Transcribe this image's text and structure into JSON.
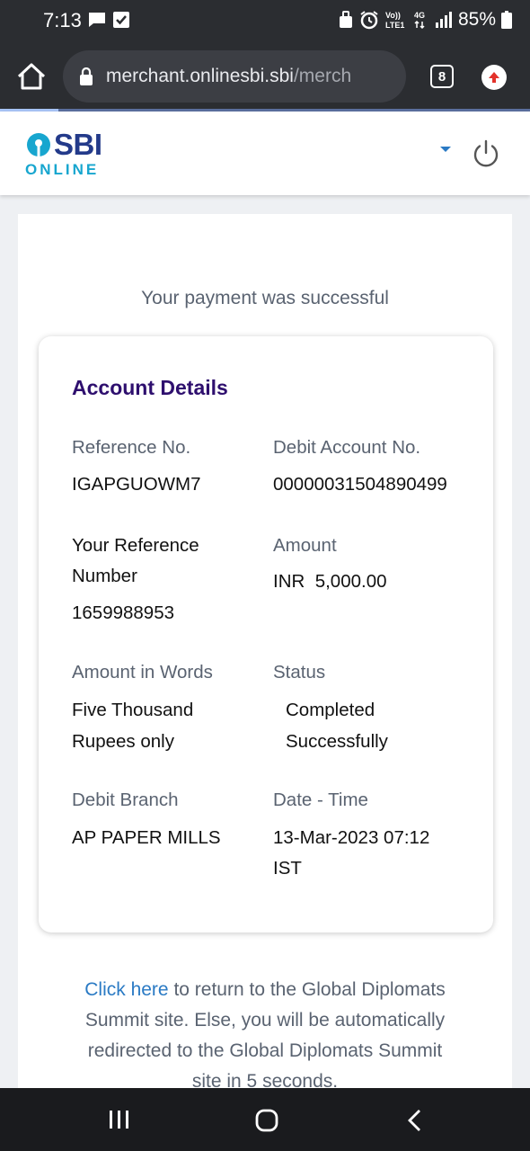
{
  "status_bar": {
    "time": "7:13",
    "battery_pct": "85%",
    "network": "4G",
    "volte": "VoLTE"
  },
  "browser": {
    "url_host": "merchant.onlinesbi.sbi",
    "url_path": "/merch",
    "tab_count": "8",
    "page_load_progress": 0.11
  },
  "header": {
    "logo_sbi": "SBI",
    "logo_online": "ONLINE"
  },
  "page": {
    "success_message": "Your payment was successful",
    "account_details_title": "Account Details",
    "fields": {
      "reference_no_label": "Reference No.",
      "reference_no_value": "IGAPGUOWM7",
      "debit_account_label": "Debit Account No.",
      "debit_account_value": "00000031504890499",
      "your_reference_label_line1": "Your Reference",
      "your_reference_label_line2": "Number",
      "your_reference_value": "1659988953",
      "amount_label": "Amount",
      "amount_value": "INR  5,000.00",
      "amount_words_label": "Amount in Words",
      "amount_words_line1": "Five Thousand",
      "amount_words_line2": "Rupees only",
      "status_label": "Status",
      "status_line1": "Completed",
      "status_line2": "Successfully",
      "debit_branch_label": "Debit Branch",
      "debit_branch_value": "AP PAPER MILLS",
      "datetime_label": "Date - Time",
      "datetime_line1": "13-Mar-2023 07:12",
      "datetime_line2": "IST"
    },
    "redirect": {
      "link_text": "Click here",
      "text_line1": " to return to the Global Diplomats",
      "text_line2": "Summit site. Else, you will be automatically",
      "text_line3": "redirected to the Global Diplomats Summit",
      "text_line4": "site in 5 seconds."
    }
  },
  "colors": {
    "title_purple": "#2e0f6e",
    "link_blue": "#2a7ac4",
    "sbi_blue": "#233a8a",
    "online_cyan": "#17a6cf"
  },
  "icons": [
    "chat-icon",
    "check-box-icon",
    "alarm-icon",
    "signal-icon",
    "battery-icon",
    "home-icon",
    "lock-icon",
    "upload-icon",
    "sbi-keyhole-icon",
    "chevron-down-icon",
    "power-icon",
    "recent-apps-icon",
    "home-circle-icon",
    "back-icon"
  ]
}
